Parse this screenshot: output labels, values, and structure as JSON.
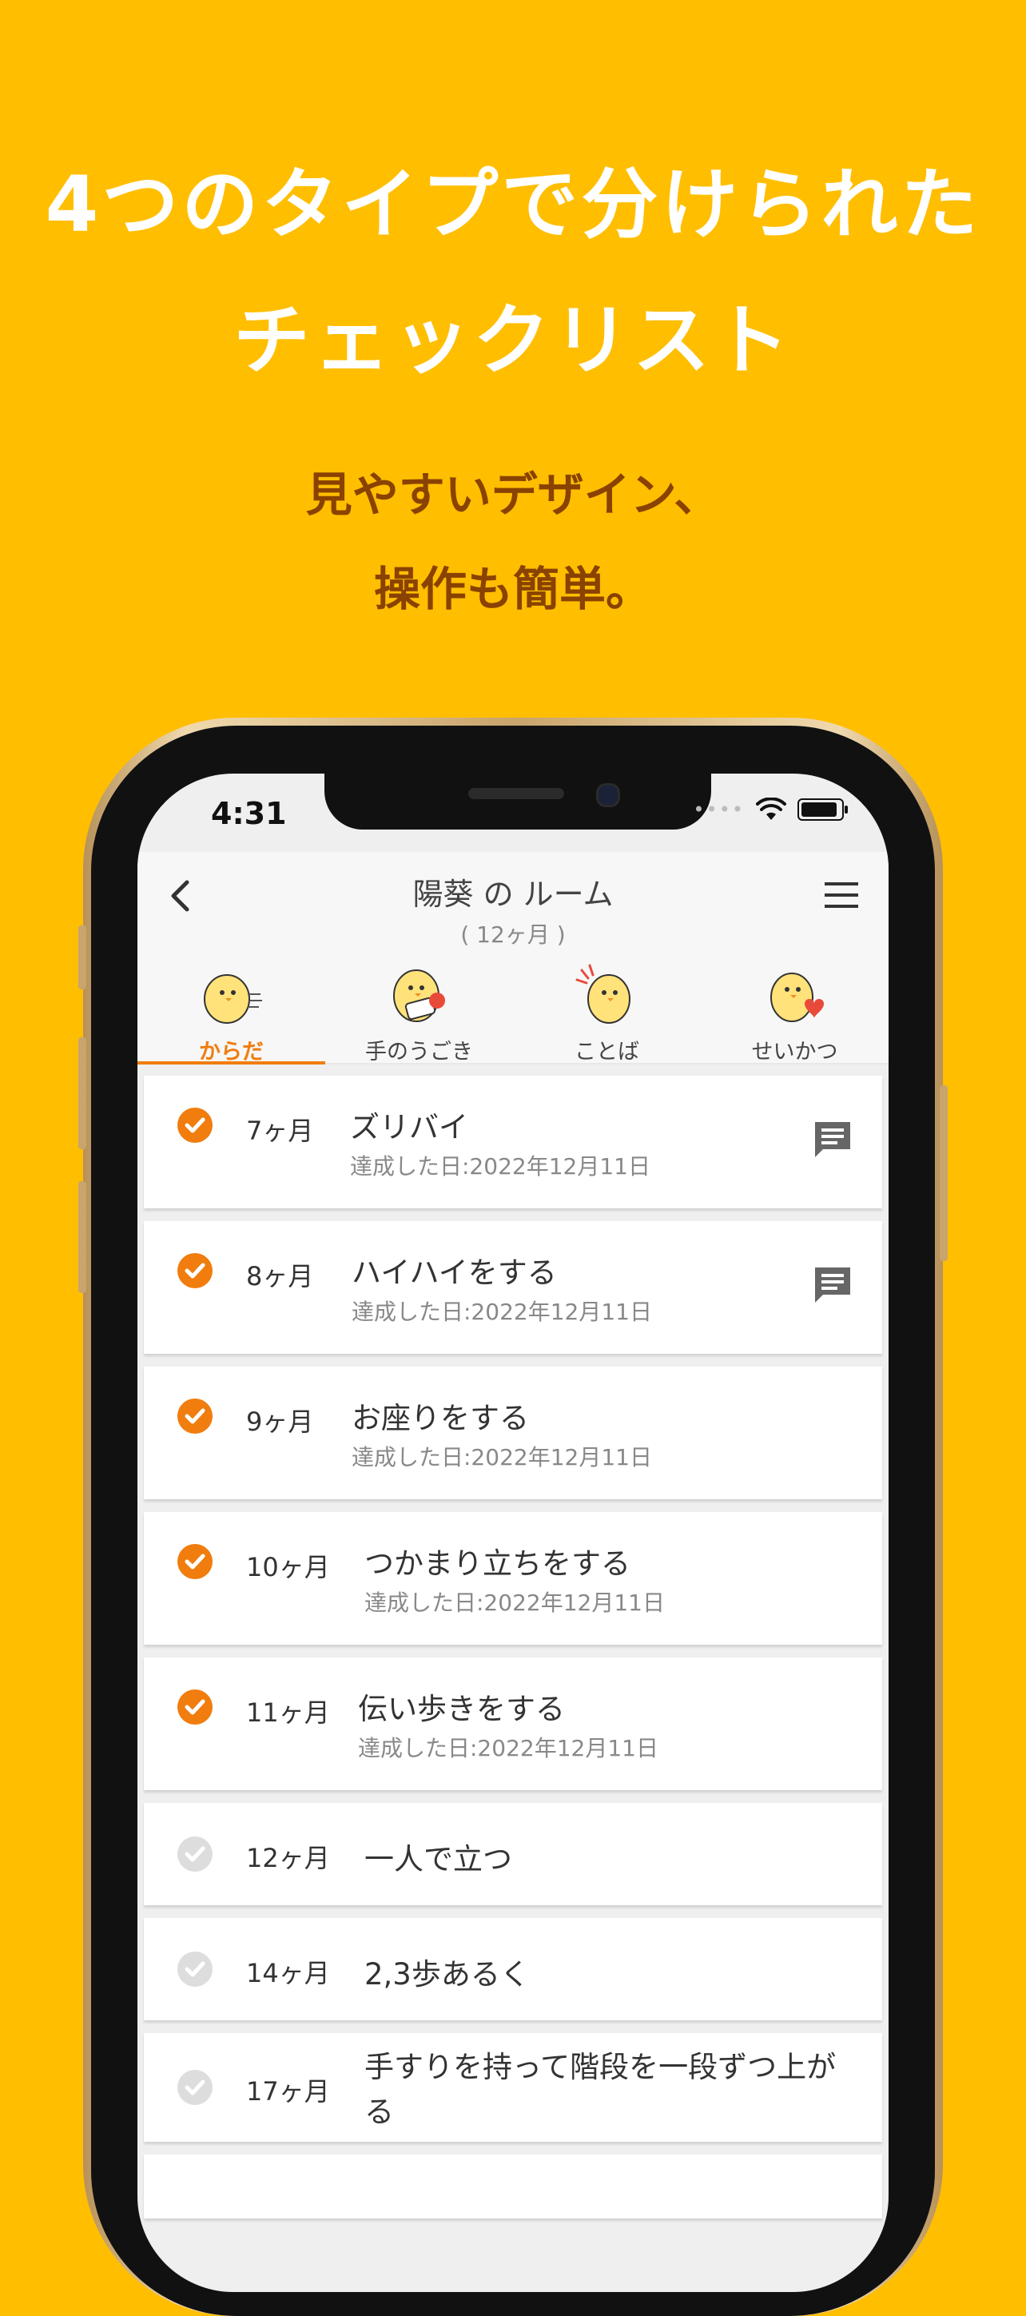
{
  "promo": {
    "line1": "4つのタイプで分けられた",
    "line2": "チェックリスト",
    "sub1": "見やすいデザイン、",
    "sub2": "操作も簡単。"
  },
  "status": {
    "time": "4:31"
  },
  "header": {
    "title": "陽葵 の ルーム",
    "age": "( 12ヶ月 )"
  },
  "tabs": [
    {
      "label": "からだ",
      "active": true
    },
    {
      "label": "手のうごき",
      "active": false
    },
    {
      "label": "ことば",
      "active": false
    },
    {
      "label": "せいかつ",
      "active": false
    }
  ],
  "items": [
    {
      "month": "7ヶ月",
      "title": "ズリバイ",
      "date": "達成した日:2022年12月11日",
      "done": true,
      "comment": true
    },
    {
      "month": "8ヶ月",
      "title": "ハイハイをする",
      "date": "達成した日:2022年12月11日",
      "done": true,
      "comment": true
    },
    {
      "month": "9ヶ月",
      "title": "お座りをする",
      "date": "達成した日:2022年12月11日",
      "done": true,
      "comment": false
    },
    {
      "month": "10ヶ月",
      "title": "つかまり立ちをする",
      "date": "達成した日:2022年12月11日",
      "done": true,
      "comment": false
    },
    {
      "month": "11ヶ月",
      "title": "伝い歩きをする",
      "date": "達成した日:2022年12月11日",
      "done": true,
      "comment": false
    },
    {
      "month": "12ヶ月",
      "title": "一人で立つ",
      "done": false,
      "comment": false
    },
    {
      "month": "14ヶ月",
      "title": "2,3歩あるく",
      "done": false,
      "comment": false
    },
    {
      "month": "17ヶ月",
      "title": "手すりを持って階段を一段ずつ上がる",
      "title_line1": "手すりを持って階段を一段ずつ上が",
      "title_line2": "る",
      "done": false,
      "comment": false
    }
  ],
  "colors": {
    "background": "#FFBE00",
    "accent": "#F07D0E",
    "check_inactive": "#DDDDDD"
  }
}
